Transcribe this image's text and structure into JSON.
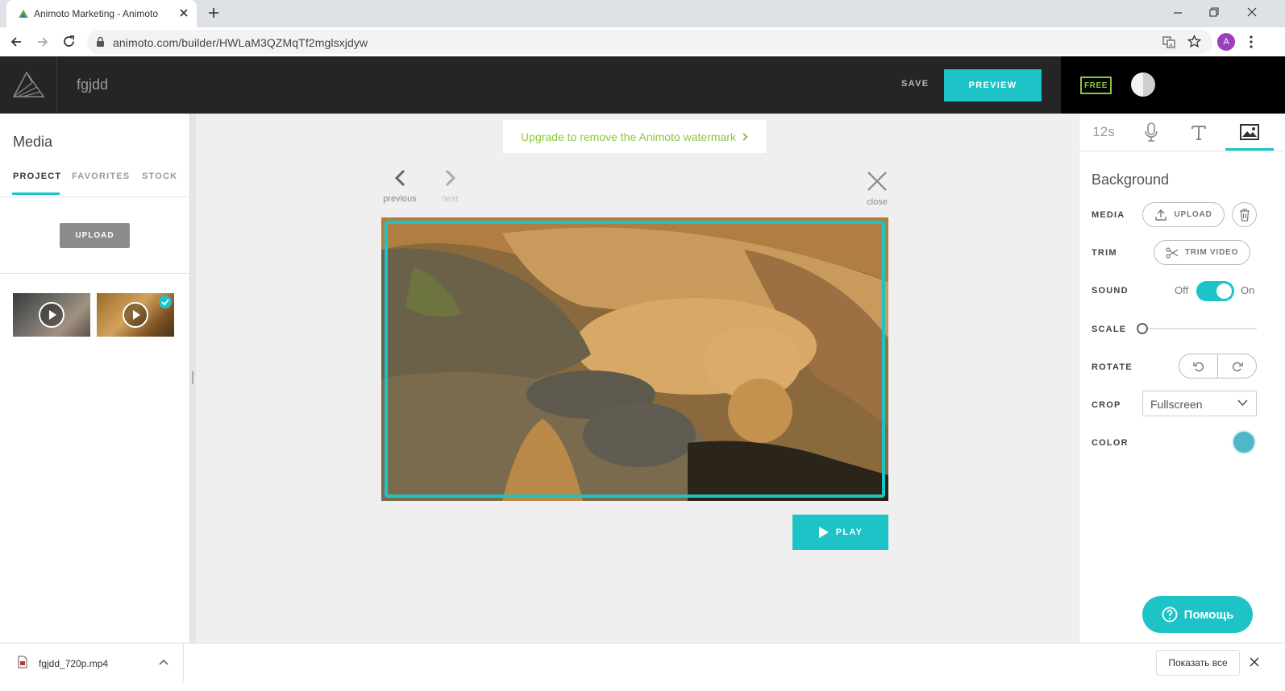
{
  "browser": {
    "tab_title": "Animoto Marketing - Animoto",
    "url": "animoto.com/builder/HWLaM3QZMqTf2mglsxjdyw",
    "profile_initial": "A"
  },
  "header": {
    "project_name": "fgjdd",
    "save_label": "SAVE",
    "preview_label": "PREVIEW",
    "plan_badge": "FREE"
  },
  "left_panel": {
    "title": "Media",
    "tabs": [
      {
        "label": "PROJECT",
        "active": true
      },
      {
        "label": "FAVORITES",
        "active": false
      },
      {
        "label": "STOCK",
        "active": false
      }
    ],
    "upload_label": "UPLOAD",
    "thumbnails": [
      {
        "type": "video",
        "selected": false
      },
      {
        "type": "video",
        "selected": true
      }
    ]
  },
  "center": {
    "upgrade_text": "Upgrade to remove the Animoto watermark",
    "previous_label": "previous",
    "next_label": "next",
    "close_label": "close",
    "play_label": "PLAY"
  },
  "right_panel": {
    "tabs": {
      "duration": "12s",
      "voice_icon": "microphone-icon",
      "text_icon": "text-icon",
      "background_icon": "image-icon"
    },
    "section_title": "Background",
    "media_label": "MEDIA",
    "upload_label": "UPLOAD",
    "trim_label": "TRIM",
    "trim_button": "TRIM VIDEO",
    "sound_label": "SOUND",
    "sound_off": "Off",
    "sound_on": "On",
    "sound_enabled": true,
    "scale_label": "SCALE",
    "scale_value": 0,
    "rotate_label": "ROTATE",
    "crop_label": "CROP",
    "crop_value": "Fullscreen",
    "color_label": "COLOR",
    "color_value": "#4db8c9",
    "help_label": "Помощь"
  },
  "downloads": {
    "filename": "fgjdd_720p.mp4",
    "show_all": "Показать все"
  },
  "colors": {
    "accent": "#1ec3c8",
    "upgrade_green": "#8cc63f",
    "header_bg": "#252525"
  }
}
